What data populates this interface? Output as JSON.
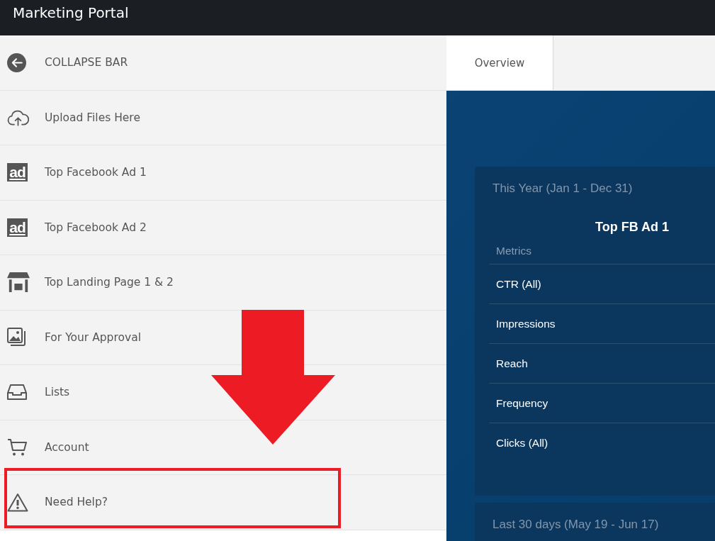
{
  "top_bar": {
    "title": "Marketing Portal"
  },
  "sidebar": {
    "items": [
      {
        "label": "COLLAPSE BAR",
        "highlighted": false
      },
      {
        "label": "Upload Files Here",
        "highlighted": false
      },
      {
        "label": "Top Facebook Ad 1",
        "badge": "ad",
        "highlighted": false
      },
      {
        "label": "Top Facebook Ad 2",
        "badge": "ad",
        "highlighted": false
      },
      {
        "label": "Top Landing Page 1 & 2",
        "highlighted": false
      },
      {
        "label": "For Your Approval",
        "highlighted": false
      },
      {
        "label": "Lists",
        "highlighted": false
      },
      {
        "label": "Account",
        "highlighted": false
      },
      {
        "label": "Need Help?",
        "highlighted": true
      }
    ]
  },
  "tabs": [
    {
      "label": "Overview",
      "selected": true
    }
  ],
  "cards": [
    {
      "title": "This Year (Jan 1 - Dec 31)",
      "heading": "Top FB Ad 1",
      "table": {
        "columns": [
          "Metrics"
        ],
        "rows": [
          "CTR (All)",
          "Impressions",
          "Reach",
          "Frequency",
          "Clicks (All)"
        ]
      }
    },
    {
      "title": "Last 30 days (May 19 - Jun 17)"
    }
  ]
}
